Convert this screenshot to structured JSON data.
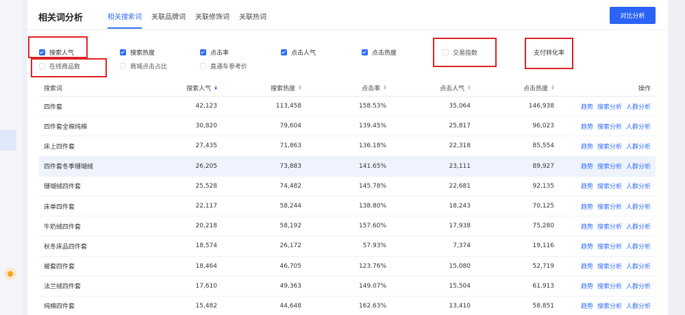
{
  "header": {
    "title": "相关词分析",
    "tabs": [
      "相关搜索词",
      "关联品牌词",
      "关联修饰词",
      "关联热词"
    ],
    "compare_button": "对比分析"
  },
  "indicators": [
    {
      "label": "搜索人气",
      "checked": true
    },
    {
      "label": "搜索热度",
      "checked": true
    },
    {
      "label": "点击率",
      "checked": true
    },
    {
      "label": "点击人气",
      "checked": true
    },
    {
      "label": "点击热度",
      "checked": true
    },
    {
      "label": "交易指数",
      "checked": false
    },
    {
      "label": "支付转化率",
      "checked": false
    },
    {
      "label": "在线商品数",
      "checked": false
    },
    {
      "label": "商城点击占比",
      "checked": false
    },
    {
      "label": "直通车参考价",
      "checked": false
    }
  ],
  "table": {
    "columns": [
      "搜索词",
      "搜索人气",
      "搜索热度",
      "点击率",
      "点击人气",
      "点击热度",
      "操作"
    ],
    "actions": [
      "趋势",
      "搜索分析",
      "人群分析"
    ],
    "rows": [
      [
        "四件套",
        "42,123",
        "113,458",
        "158.53%",
        "35,064",
        "146,938"
      ],
      [
        "四件套全棉纯棉",
        "30,820",
        "79,604",
        "139.45%",
        "25,817",
        "96,023"
      ],
      [
        "床上四件套",
        "27,435",
        "71,863",
        "136.18%",
        "22,318",
        "85,554"
      ],
      [
        "四件套冬季珊瑚绒",
        "26,205",
        "73,883",
        "141.65%",
        "23,111",
        "89,927"
      ],
      [
        "珊瑚绒四件套",
        "25,528",
        "74,482",
        "145.78%",
        "22,681",
        "92,135"
      ],
      [
        "床单四件套",
        "22,117",
        "58,244",
        "138.80%",
        "18,243",
        "70,125"
      ],
      [
        "牛奶绒四件套",
        "20,218",
        "58,192",
        "157.60%",
        "17,938",
        "75,280"
      ],
      [
        "秋冬床品四件套",
        "18,574",
        "26,172",
        "57.93%",
        "7,374",
        "19,116"
      ],
      [
        "被套四件套",
        "18,464",
        "46,705",
        "123.76%",
        "15,080",
        "52,719"
      ],
      [
        "法兰绒四件套",
        "17,610",
        "49,363",
        "149.07%",
        "15,504",
        "61,913"
      ],
      [
        "纯棉四件套",
        "15,482",
        "44,648",
        "162.63%",
        "13,410",
        "58,851"
      ]
    ]
  },
  "colors": {
    "accent": "#2f6cf6",
    "annotation": "#e02020",
    "highlight_row": "#eef3fd"
  }
}
